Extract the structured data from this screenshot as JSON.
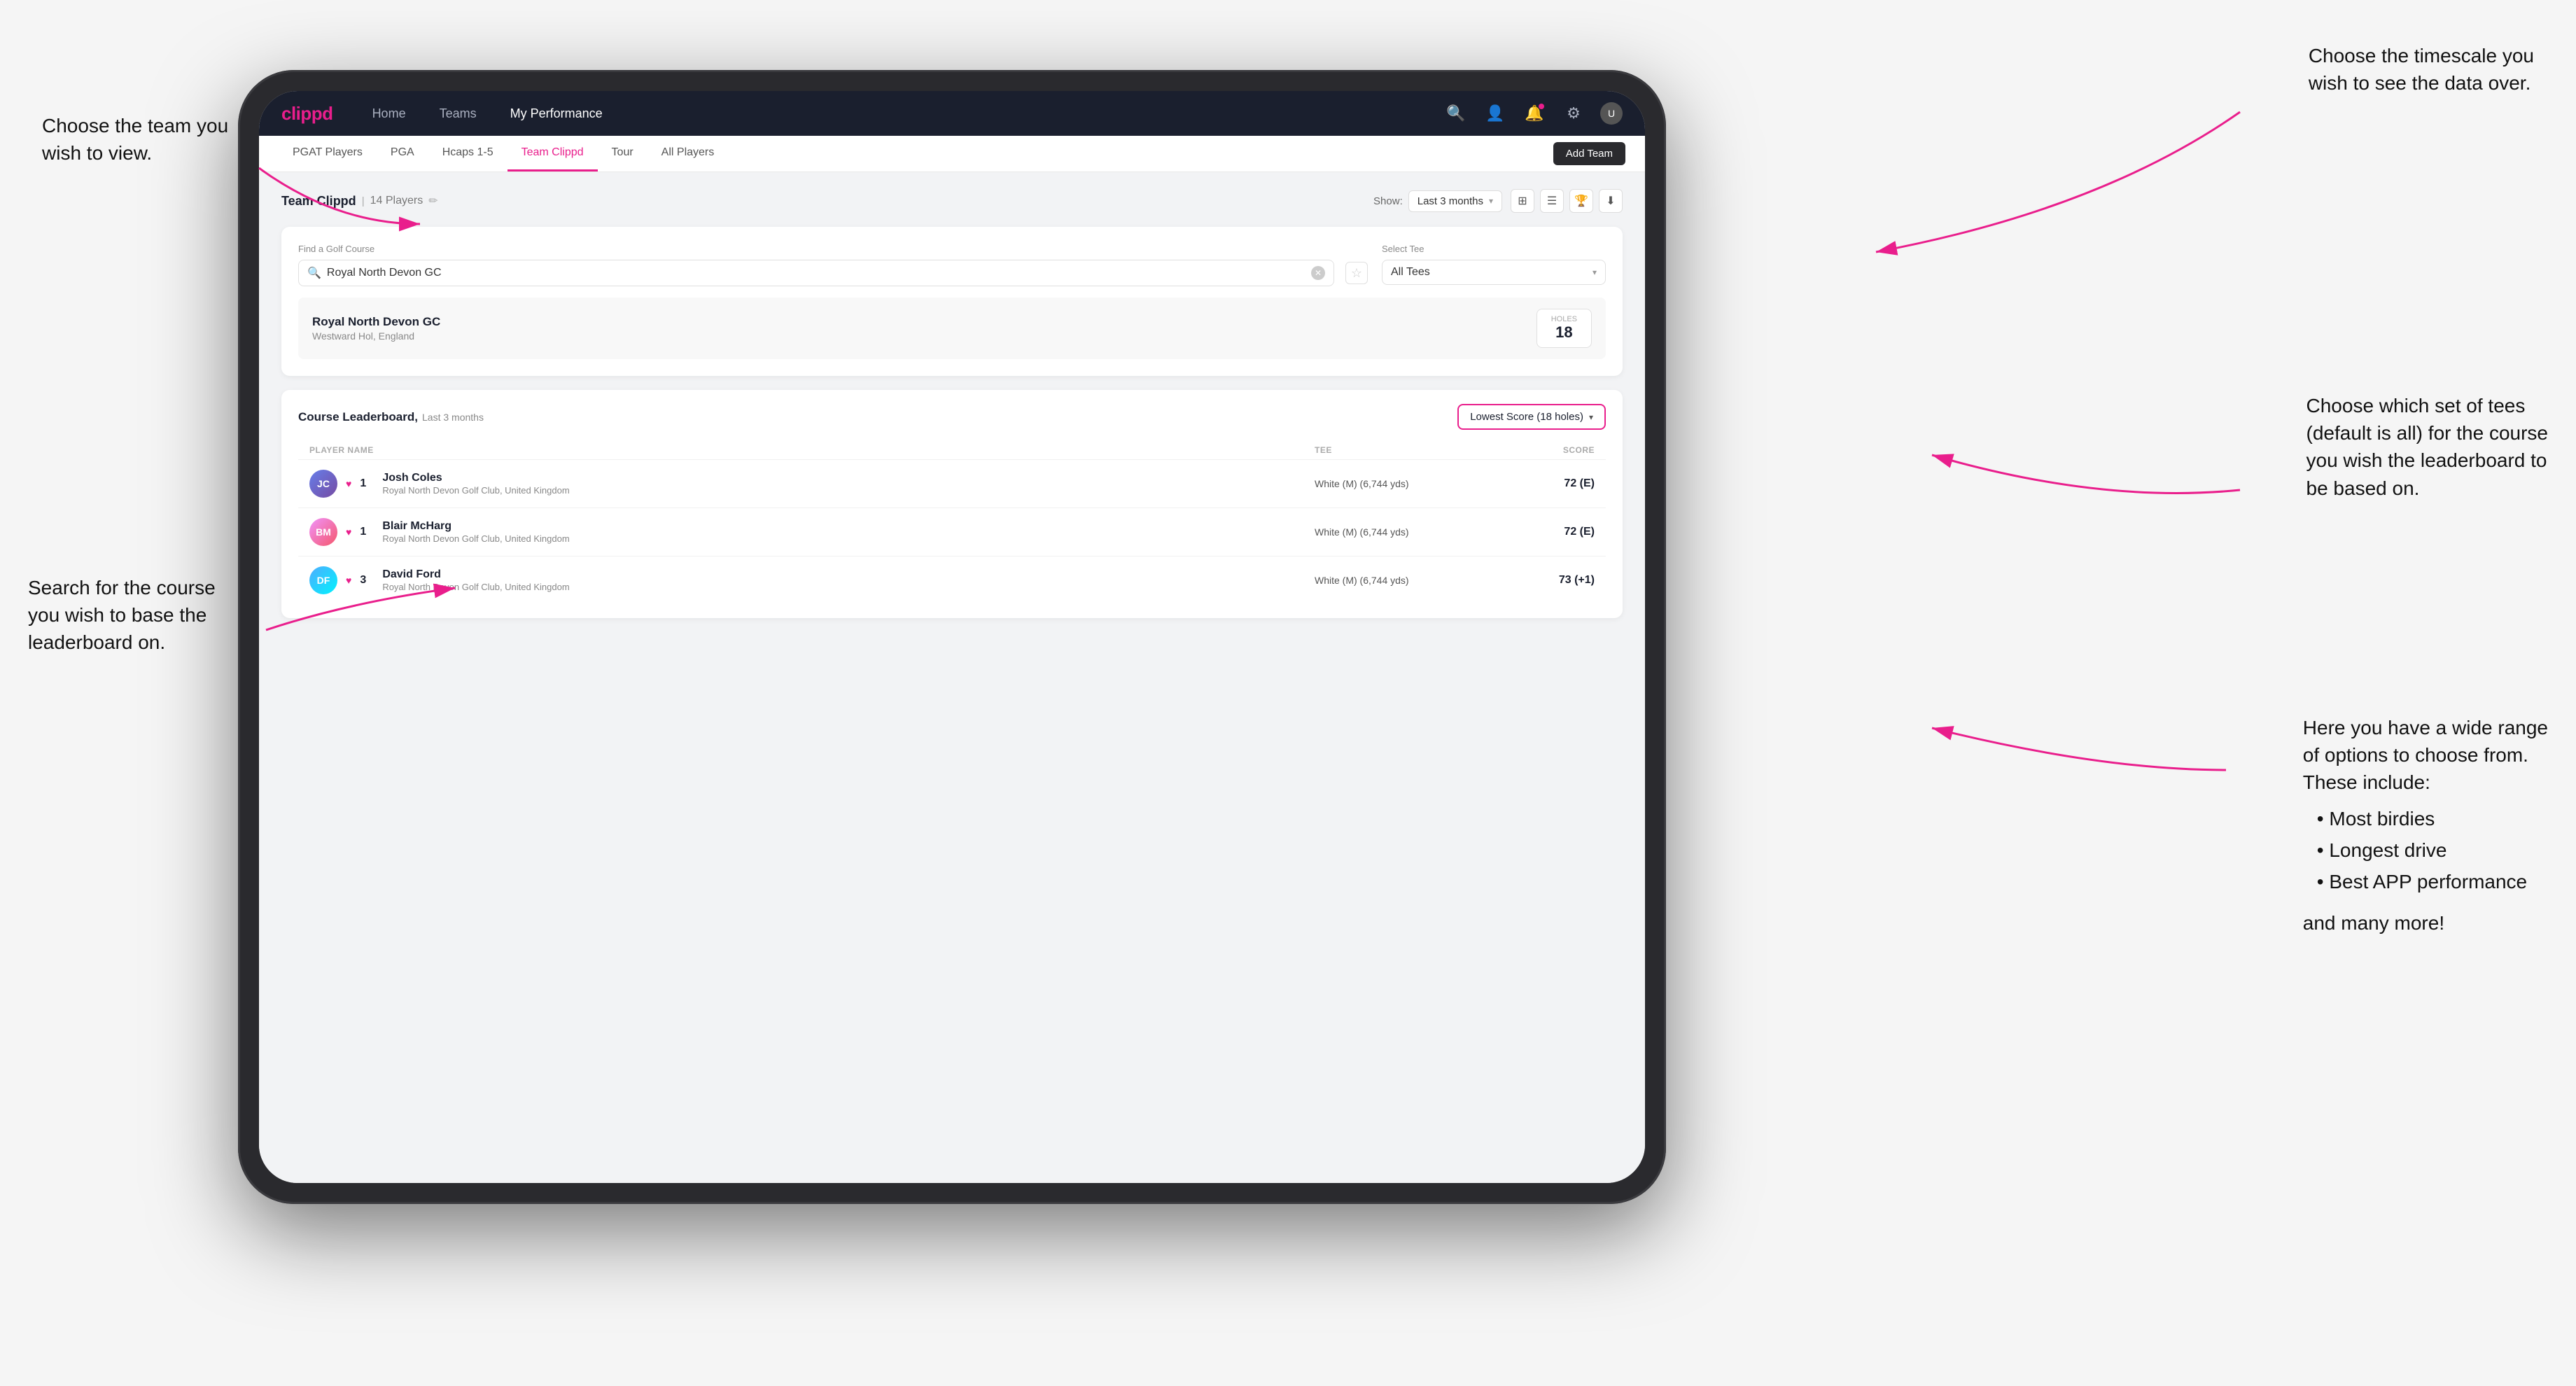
{
  "app": {
    "logo": "clippd",
    "nav": {
      "links": [
        "Home",
        "Teams",
        "My Performance"
      ],
      "active": "My Performance"
    },
    "subnav": {
      "items": [
        "PGAT Players",
        "PGA",
        "Hcaps 1-5",
        "Team Clippd",
        "Tour",
        "All Players"
      ],
      "active": "Team Clippd",
      "add_team_label": "Add Team"
    }
  },
  "team_header": {
    "title": "Team Clippd",
    "separator": "|",
    "count": "14 Players",
    "show_label": "Show:",
    "show_value": "Last 3 months"
  },
  "search_panel": {
    "find_label": "Find a Golf Course",
    "search_placeholder": "Royal North Devon GC",
    "search_value": "Royal North Devon GC",
    "tee_label": "Select Tee",
    "tee_value": "All Tees"
  },
  "course_result": {
    "name": "Royal North Devon GC",
    "location": "Westward Hol, England",
    "holes_label": "Holes",
    "holes_value": "18"
  },
  "leaderboard": {
    "title": "Course Leaderboard,",
    "subtitle": "Last 3 months",
    "score_select_label": "Lowest Score (18 holes)",
    "columns": {
      "player": "PLAYER NAME",
      "tee": "TEE",
      "score": "SCORE"
    },
    "rows": [
      {
        "rank": "1",
        "name": "Josh Coles",
        "club": "Royal North Devon Golf Club, United Kingdom",
        "tee": "White (M) (6,744 yds)",
        "score": "72 (E)",
        "initials": "JC"
      },
      {
        "rank": "1",
        "name": "Blair McHarg",
        "club": "Royal North Devon Golf Club, United Kingdom",
        "tee": "White (M) (6,744 yds)",
        "score": "72 (E)",
        "initials": "BM"
      },
      {
        "rank": "3",
        "name": "David Ford",
        "club": "Royal North Devon Golf Club, United Kingdom",
        "tee": "White (M) (6,744 yds)",
        "score": "73 (+1)",
        "initials": "DF"
      }
    ]
  },
  "annotations": {
    "top_left": {
      "line1": "Choose the team you",
      "line2": "wish to view."
    },
    "top_right": {
      "line1": "Choose the timescale you",
      "line2": "wish to see the data over."
    },
    "middle_right": {
      "line1": "Choose which set of tees",
      "line2": "(default is all) for the course",
      "line3": "you wish the leaderboard to",
      "line4": "be based on."
    },
    "bottom_left": {
      "line1": "Search for the course",
      "line2": "you wish to base the",
      "line3": "leaderboard on."
    },
    "bottom_right": {
      "line1": "Here you have a wide range",
      "line2": "of options to choose from.",
      "line3": "These include:",
      "bullets": [
        "Most birdies",
        "Longest drive",
        "Best APP performance"
      ],
      "footer": "and many more!"
    }
  }
}
